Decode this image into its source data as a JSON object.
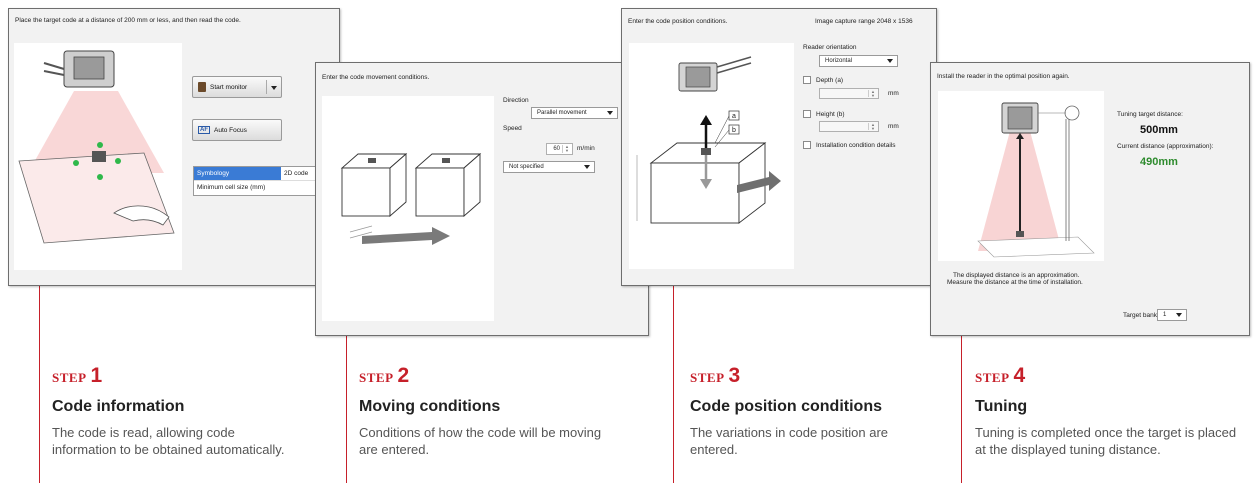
{
  "screens": {
    "s1": {
      "instruction": "Place the target code at a distance of 200 mm or less, and then read the code.",
      "start_monitor": "Start monitor",
      "auto_focus": "Auto Focus",
      "af_badge": "AF",
      "table": {
        "rows": [
          {
            "label": "Symbology",
            "value": "2D code"
          },
          {
            "label": "Minimum cell size (mm)",
            "value": ""
          }
        ]
      }
    },
    "s2": {
      "instruction": "Enter the code movement conditions.",
      "direction_label": "Direction",
      "direction_value": "Parallel movement",
      "speed_label": "Speed",
      "speed_value": "60",
      "speed_unit": "m/min",
      "speed_mode": "Not specified"
    },
    "s3": {
      "instruction": "Enter the code position conditions.",
      "capture_range": "Image capture range  2048 x 1536",
      "orientation_label": "Reader orientation",
      "orientation_value": "Horizontal",
      "depth_label": "Depth (a)",
      "height_label": "Height (b)",
      "unit_mm": "mm",
      "details_label": "Installation condition details",
      "callout_a": "a",
      "callout_b": "b"
    },
    "s4": {
      "instruction": "Install the reader in the optimal position again.",
      "target_distance_label": "Tuning target distance:",
      "target_distance_value": "500mm",
      "current_distance_label": "Current distance (approximation):",
      "current_distance_value": "490mm",
      "note_line1": "The displayed distance is an approximation.",
      "note_line2": "Measure the distance at the time of installation.",
      "target_bank_label": "Target bank",
      "target_bank_value": "1"
    }
  },
  "steps": [
    {
      "word": "STEP",
      "number": "1",
      "title": "Code information",
      "desc": "The code is read, allowing code information to be obtained automatically."
    },
    {
      "word": "STEP",
      "number": "2",
      "title": "Moving conditions",
      "desc": "Conditions of how the code will be moving are entered."
    },
    {
      "word": "STEP",
      "number": "3",
      "title": "Code position conditions",
      "desc": "The variations in code position are entered."
    },
    {
      "word": "STEP",
      "number": "4",
      "title": "Tuning",
      "desc": "Tuning is completed once the target is placed at the displayed tuning distance."
    }
  ],
  "colors": {
    "accent": "#c6202a",
    "green_value": "#2e8b2e",
    "selection": "#3a7bd5"
  }
}
